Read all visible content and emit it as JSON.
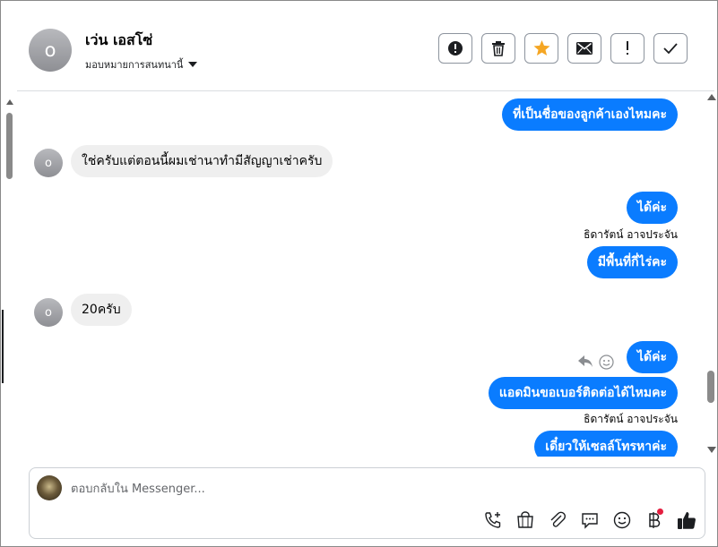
{
  "contact": {
    "initial": "o",
    "name": "เว่น เอสโซ่",
    "assign_label": "มอบหมายการสนทนานี้"
  },
  "header_actions": [
    {
      "name": "spam-button",
      "icon": "exclamation-circle-icon"
    },
    {
      "name": "delete-button",
      "icon": "trash-icon"
    },
    {
      "name": "follow-up-button",
      "icon": "star-icon"
    },
    {
      "name": "mark-unread-button",
      "icon": "envelope-icon"
    },
    {
      "name": "priority-button",
      "icon": "exclamation-icon"
    },
    {
      "name": "mark-done-button",
      "icon": "check-icon"
    }
  ],
  "messages": [
    {
      "dir": "out",
      "text": "ที่เป็นชื่อของลูกค้าเองไหมคะ"
    },
    {
      "dir": "in",
      "text": "ใช่ครับแต่ตอนนี้ผมเช่านาทำมีสัญญาเช่าครับ"
    },
    {
      "dir": "out",
      "text": "ได้ค่ะ"
    },
    {
      "dir": "sender",
      "text": "ธิดารัตน์ อาจประจัน"
    },
    {
      "dir": "out",
      "text": "มีพื้นที่กี่ไร่คะ"
    },
    {
      "dir": "in",
      "text": "20ครับ"
    },
    {
      "dir": "out",
      "text": "ได้ค่ะ"
    },
    {
      "dir": "out",
      "text": "แอดมินขอเบอร์ติดต่อได้ไหมคะ"
    },
    {
      "dir": "sender",
      "text": "ธิดารัตน์ อาจประจัน"
    },
    {
      "dir": "out",
      "text": "เดี๋ยวให้เซลล์โทรหาค่ะ"
    }
  ],
  "composer": {
    "placeholder": "ตอบกลับใน Messenger...",
    "tools": [
      "call-icon",
      "shop-icon",
      "attachment-icon",
      "saved-reply-icon",
      "emoji-icon",
      "baht-icon",
      "thumbs-up-icon"
    ]
  },
  "colors": {
    "outgoing_bubble": "#0a7cff",
    "incoming_bubble": "#efefef",
    "star": "#f5a623",
    "notification_dot": "#e41e3f"
  }
}
